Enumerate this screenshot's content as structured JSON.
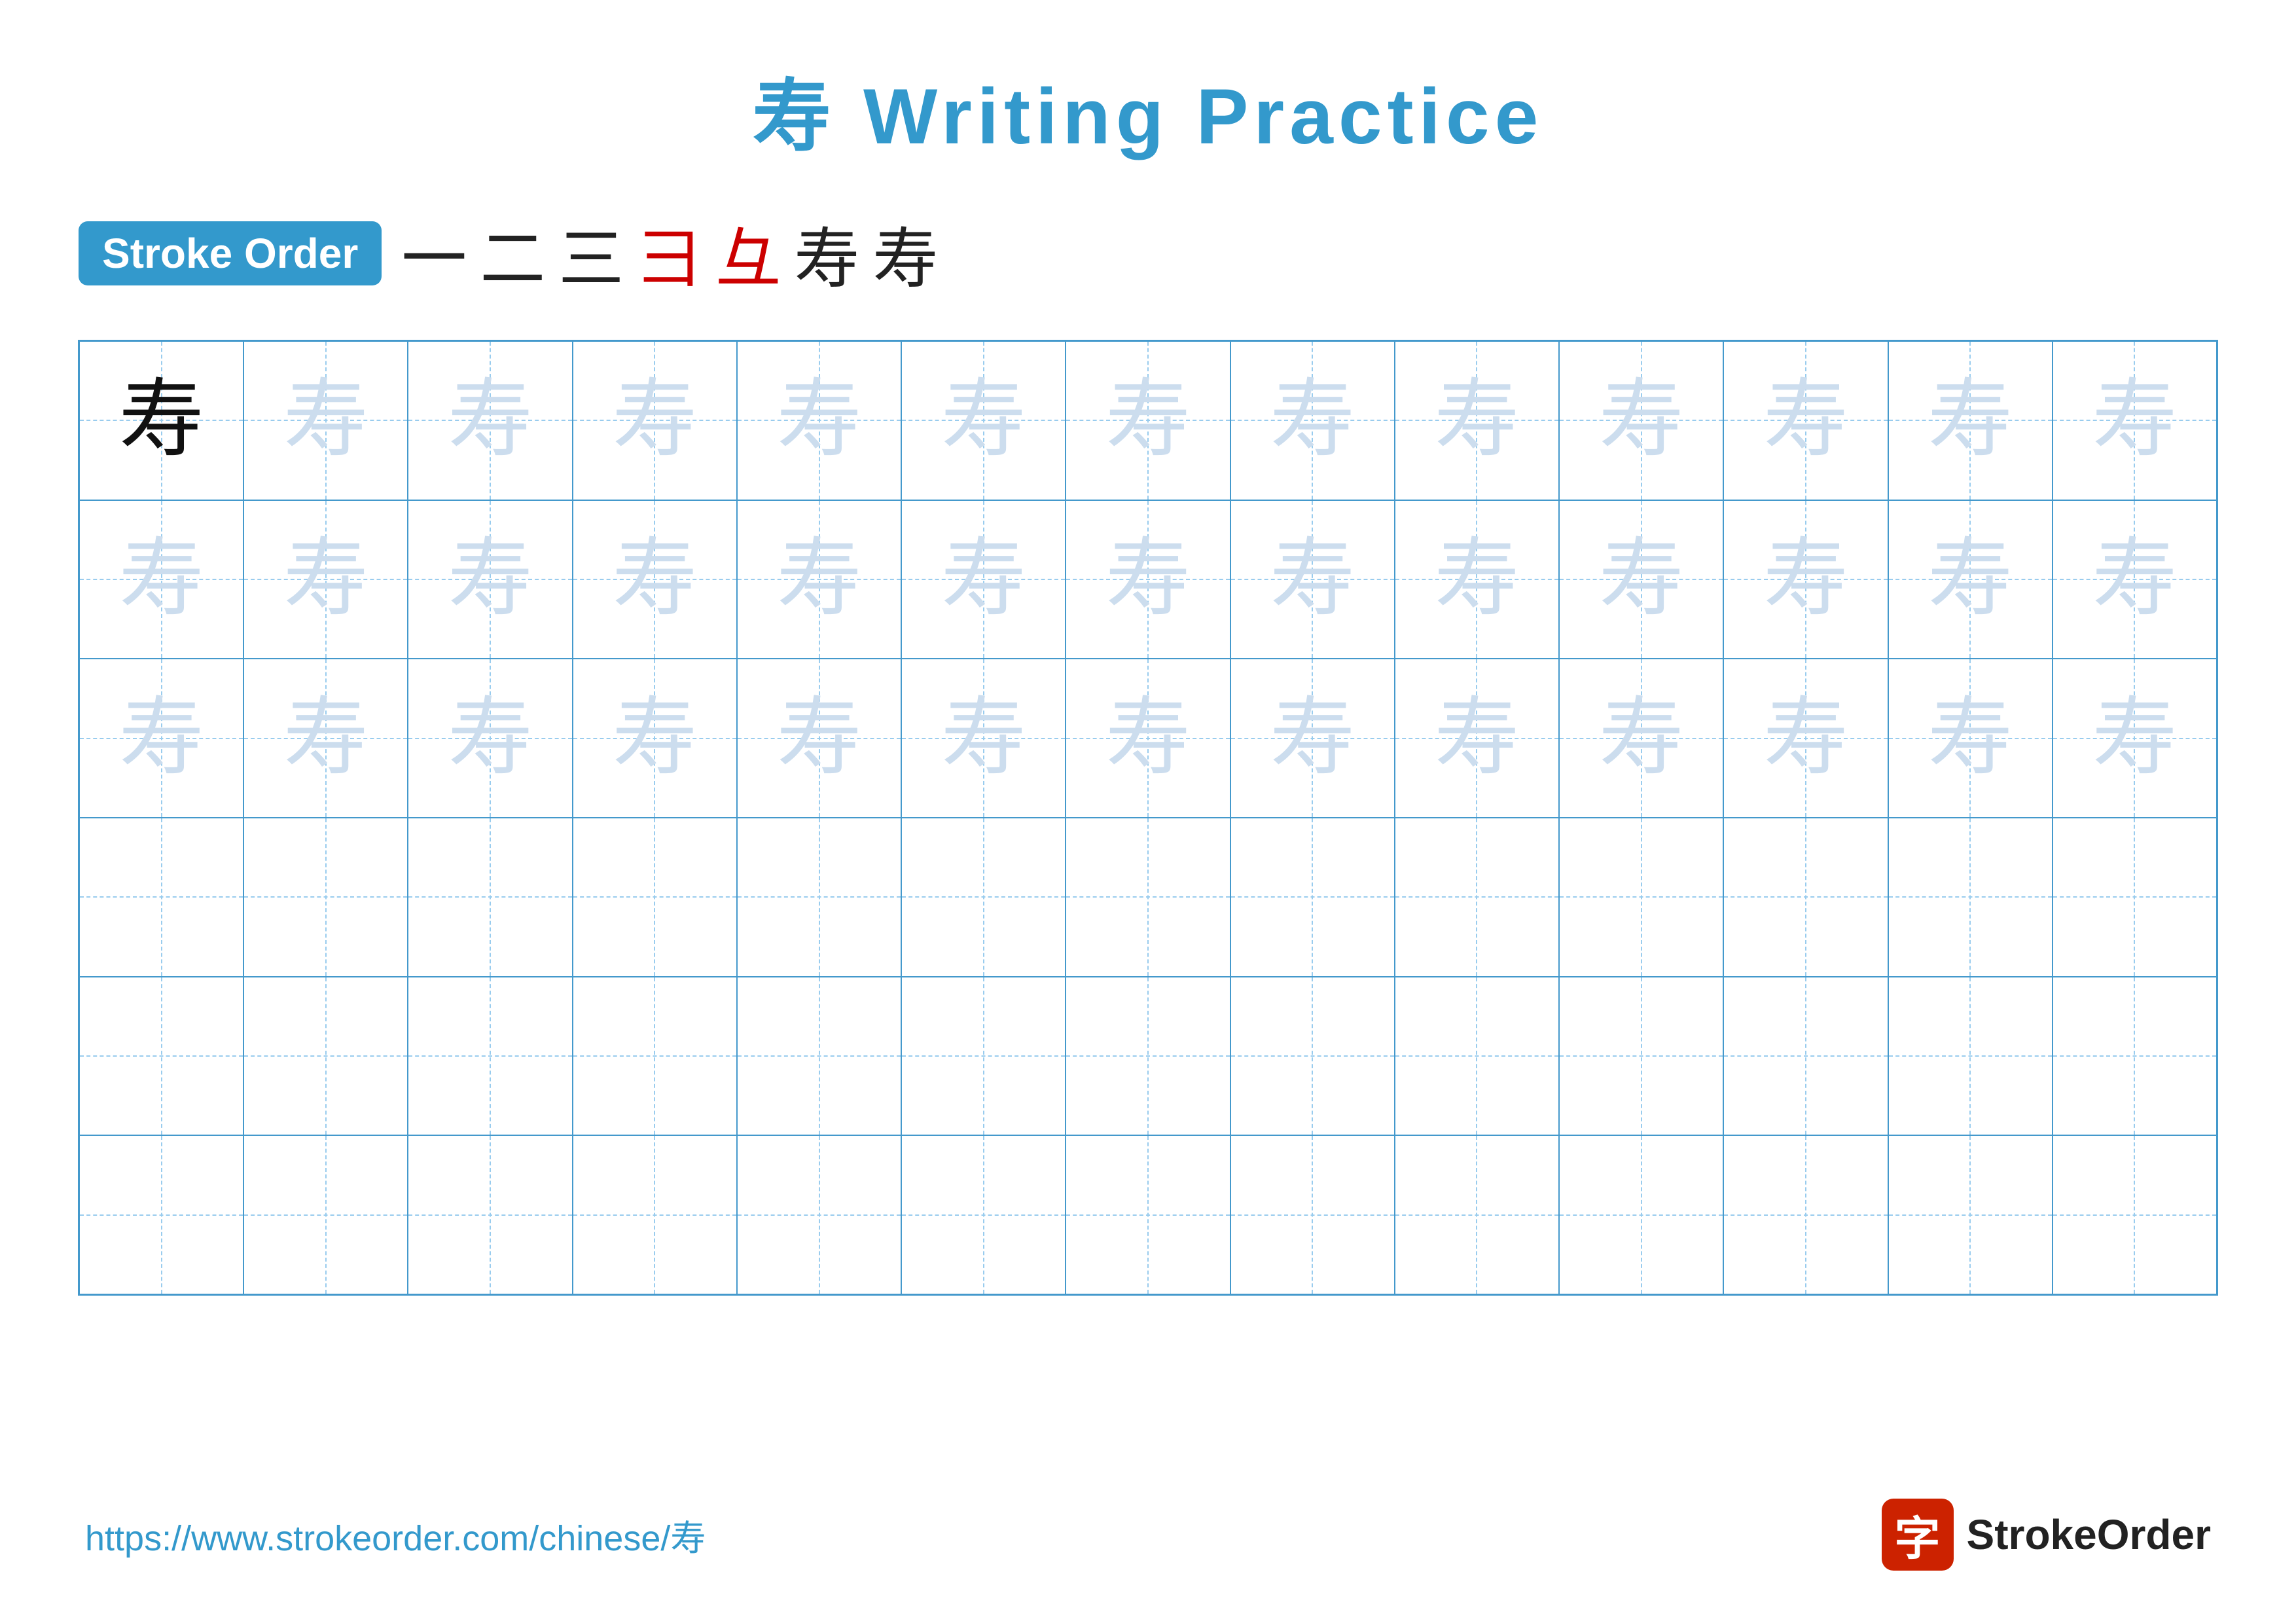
{
  "title": "寿 Writing Practice",
  "stroke_order": {
    "label": "Stroke Order",
    "strokes": [
      "一",
      "二",
      "三",
      "彐",
      "彑",
      "寿",
      "寿"
    ],
    "stroke_colors": [
      "black",
      "black",
      "black",
      "red",
      "red",
      "black",
      "black"
    ]
  },
  "character": "寿",
  "grid": {
    "cols": 13,
    "rows": 6,
    "cells": [
      {
        "row": 0,
        "col": 0,
        "style": "dark"
      },
      {
        "row": 0,
        "col": 1,
        "style": "light"
      },
      {
        "row": 0,
        "col": 2,
        "style": "light"
      },
      {
        "row": 0,
        "col": 3,
        "style": "light"
      },
      {
        "row": 0,
        "col": 4,
        "style": "light"
      },
      {
        "row": 0,
        "col": 5,
        "style": "light"
      },
      {
        "row": 0,
        "col": 6,
        "style": "light"
      },
      {
        "row": 0,
        "col": 7,
        "style": "light"
      },
      {
        "row": 0,
        "col": 8,
        "style": "light"
      },
      {
        "row": 0,
        "col": 9,
        "style": "light"
      },
      {
        "row": 0,
        "col": 10,
        "style": "light"
      },
      {
        "row": 0,
        "col": 11,
        "style": "light"
      },
      {
        "row": 0,
        "col": 12,
        "style": "light"
      },
      {
        "row": 1,
        "col": 0,
        "style": "light"
      },
      {
        "row": 1,
        "col": 1,
        "style": "light"
      },
      {
        "row": 1,
        "col": 2,
        "style": "light"
      },
      {
        "row": 1,
        "col": 3,
        "style": "light"
      },
      {
        "row": 1,
        "col": 4,
        "style": "light"
      },
      {
        "row": 1,
        "col": 5,
        "style": "light"
      },
      {
        "row": 1,
        "col": 6,
        "style": "light"
      },
      {
        "row": 1,
        "col": 7,
        "style": "light"
      },
      {
        "row": 1,
        "col": 8,
        "style": "light"
      },
      {
        "row": 1,
        "col": 9,
        "style": "light"
      },
      {
        "row": 1,
        "col": 10,
        "style": "light"
      },
      {
        "row": 1,
        "col": 11,
        "style": "light"
      },
      {
        "row": 1,
        "col": 12,
        "style": "light"
      },
      {
        "row": 2,
        "col": 0,
        "style": "light"
      },
      {
        "row": 2,
        "col": 1,
        "style": "light"
      },
      {
        "row": 2,
        "col": 2,
        "style": "light"
      },
      {
        "row": 2,
        "col": 3,
        "style": "light"
      },
      {
        "row": 2,
        "col": 4,
        "style": "light"
      },
      {
        "row": 2,
        "col": 5,
        "style": "light"
      },
      {
        "row": 2,
        "col": 6,
        "style": "light"
      },
      {
        "row": 2,
        "col": 7,
        "style": "light"
      },
      {
        "row": 2,
        "col": 8,
        "style": "light"
      },
      {
        "row": 2,
        "col": 9,
        "style": "light"
      },
      {
        "row": 2,
        "col": 10,
        "style": "light"
      },
      {
        "row": 2,
        "col": 11,
        "style": "light"
      },
      {
        "row": 2,
        "col": 12,
        "style": "light"
      }
    ]
  },
  "footer": {
    "url": "https://www.strokeorder.com/chinese/寿",
    "logo_text": "StrokeOrder",
    "logo_char": "字"
  }
}
